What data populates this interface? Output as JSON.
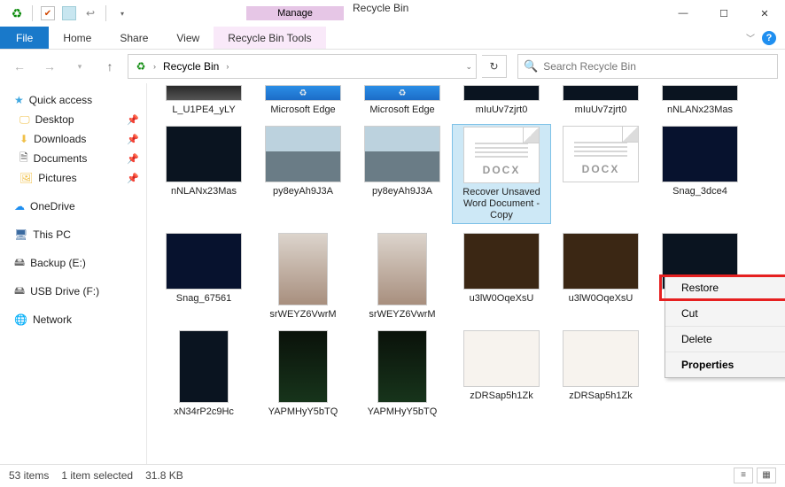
{
  "window": {
    "title": "Recycle Bin",
    "manage_label": "Manage"
  },
  "ribbon": {
    "file": "File",
    "tabs": [
      "Home",
      "Share",
      "View"
    ],
    "contextual": "Recycle Bin Tools"
  },
  "address": {
    "path": "Recycle Bin",
    "search_placeholder": "Search Recycle Bin"
  },
  "sidebar": {
    "quick_access": "Quick access",
    "pinned": [
      {
        "label": "Desktop",
        "icon": "desktop"
      },
      {
        "label": "Downloads",
        "icon": "download"
      },
      {
        "label": "Documents",
        "icon": "document"
      },
      {
        "label": "Pictures",
        "icon": "picture"
      }
    ],
    "onedrive": "OneDrive",
    "this_pc": "This PC",
    "drives": [
      {
        "label": "Backup (E:)"
      },
      {
        "label": "USB Drive (F:)"
      }
    ],
    "network": "Network"
  },
  "files": {
    "row0": [
      {
        "label": "L_U1PE4_yLY",
        "type": "photo"
      },
      {
        "label": "Microsoft Edge",
        "type": "edge"
      },
      {
        "label": "Microsoft Edge",
        "type": "edge"
      },
      {
        "label": "mIuUv7zjrt0",
        "type": "dark"
      },
      {
        "label": "mIuUv7zjrt0",
        "type": "dark"
      },
      {
        "label": "nNLANx23Mas",
        "type": "dark"
      }
    ],
    "row1": [
      {
        "label": "nNLANx23Mas",
        "type": "dark"
      },
      {
        "label": "py8eyAh9J3A",
        "type": "city"
      },
      {
        "label": "py8eyAh9J3A",
        "type": "city"
      },
      {
        "label": "Recover Unsaved Word Document - Copy",
        "type": "docx",
        "selected": true,
        "docx": "DOCX"
      },
      {
        "label": "",
        "type": "docx",
        "docx": "DOCX"
      },
      {
        "label": "Snag_3dce4",
        "type": "term"
      }
    ],
    "row2": [
      {
        "label": "Snag_67561",
        "type": "term"
      },
      {
        "label": "srWEYZ6VwrM",
        "type": "portrait"
      },
      {
        "label": "srWEYZ6VwrM",
        "type": "portrait"
      },
      {
        "label": "u3lW0OqeXsU",
        "type": "brown"
      },
      {
        "label": "u3lW0OqeXsU",
        "type": "brown"
      },
      {
        "label": "xN34rP2c9Hc",
        "type": "dark"
      }
    ],
    "row3": [
      {
        "label": "xN34rP2c9Hc",
        "type": "dark-port"
      },
      {
        "label": "YAPMHyY5bTQ",
        "type": "green-port"
      },
      {
        "label": "YAPMHyY5bTQ",
        "type": "green-port"
      },
      {
        "label": "zDRSap5h1Zk",
        "type": "cup"
      },
      {
        "label": "zDRSap5h1Zk",
        "type": "cup"
      }
    ]
  },
  "context_menu": {
    "items": [
      "Restore",
      "Cut",
      "Delete",
      "Properties"
    ]
  },
  "status": {
    "count": "53 items",
    "selection": "1 item selected",
    "size": "31.8 KB"
  }
}
